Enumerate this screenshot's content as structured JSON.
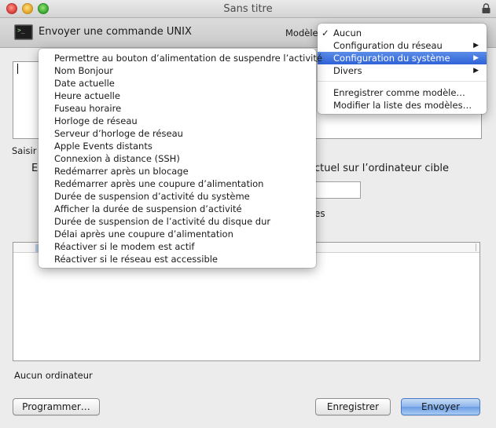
{
  "window": {
    "title": "Sans titre"
  },
  "header": {
    "title": "Envoyer une commande UNIX",
    "template_label": "Modèle"
  },
  "body": {
    "small_label": "Saisir",
    "big_label_left": "E",
    "big_label_right": "ctuel sur l’ordinateur cible",
    "mid_label": "es",
    "status": "Aucun ordinateur"
  },
  "buttons": {
    "schedule": "Programmer…",
    "save": "Enregistrer",
    "send": "Envoyer"
  },
  "template_menu": {
    "checkmark": "✓",
    "items": [
      {
        "label": "Aucun",
        "checked": true
      },
      {
        "label": "Configuration du réseau",
        "submenu": true
      },
      {
        "label": "Configuration du système",
        "submenu": true,
        "selected": true
      },
      {
        "label": "Divers",
        "submenu": true
      }
    ],
    "actions": [
      "Enregistrer comme modèle…",
      "Modifier la liste des modèles…"
    ]
  },
  "command_menu": {
    "items": [
      "Permettre au bouton d’alimentation de suspendre l’activité",
      "Nom Bonjour",
      "Date actuelle",
      "Heure actuelle",
      "Fuseau horaire",
      "Horloge de réseau",
      "Serveur d’horloge de réseau",
      "Apple Events distants",
      "Connexion à distance (SSH)",
      "Redémarrer après un blocage",
      "Redémarrer après une coupure d’alimentation",
      "Durée de suspension d’activité du système",
      "Afficher la durée de suspension d’activité",
      "Durée de suspension de l’activité du disque dur",
      "Délai après une coupure d’alimentation",
      "Réactiver si le modem est actif",
      "Réactiver si le réseau est accessible"
    ]
  },
  "icons": {
    "submenu_arrow": "▶",
    "terminal": ">_"
  },
  "colors": {
    "selection": "#2f63d8",
    "default_button": "#6b9de3"
  }
}
